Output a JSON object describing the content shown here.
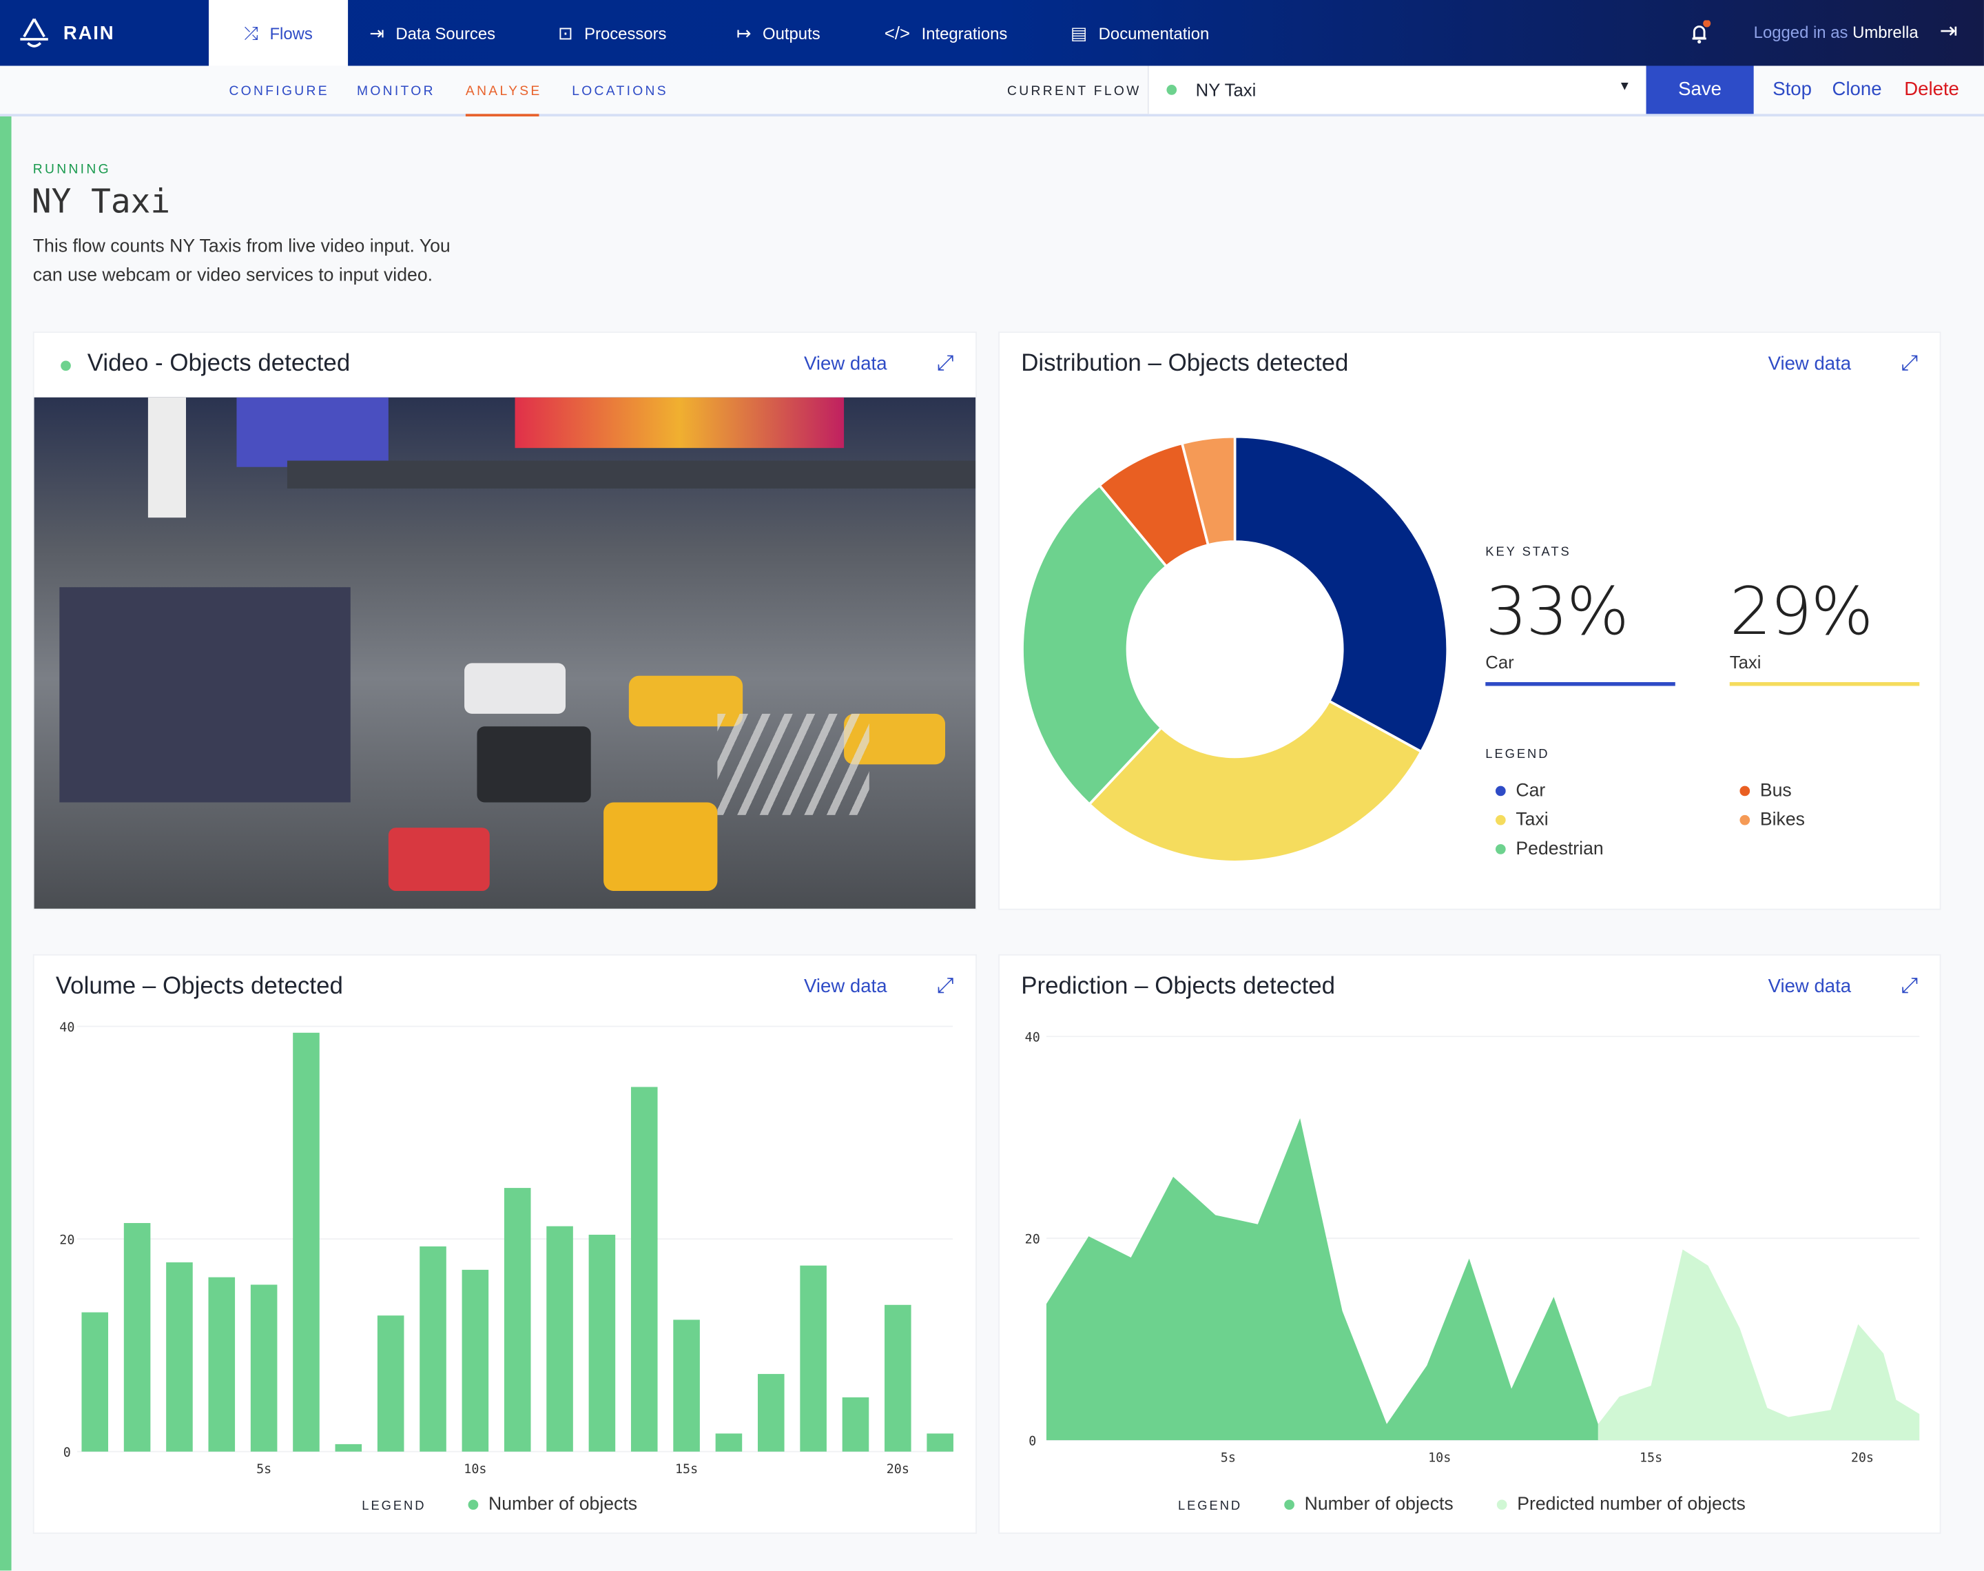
{
  "nav": {
    "brand": "RAIN",
    "items": [
      {
        "label": "Flows",
        "icon": "shuffle-icon",
        "active": true
      },
      {
        "label": "Data Sources",
        "icon": "arrow-to-right-icon"
      },
      {
        "label": "Processors",
        "icon": "robot-icon"
      },
      {
        "label": "Outputs",
        "icon": "arrow-from-bar-icon"
      },
      {
        "label": "Integrations",
        "icon": "code-icon"
      },
      {
        "label": "Documentation",
        "icon": "document-icon"
      }
    ],
    "logged_in_prefix": "Logged in as",
    "user": "Umbrella",
    "notification_color": "#e8622c"
  },
  "subnav": {
    "tabs": [
      {
        "label": "CONFIGURE"
      },
      {
        "label": "MONITOR"
      },
      {
        "label": "ANALYSE",
        "active": true
      },
      {
        "label": "LOCATIONS"
      }
    ],
    "current_flow_label": "CURRENT FLOW",
    "current_flow_value": "NY Taxi",
    "save": "Save",
    "stop": "Stop",
    "clone": "Clone",
    "delete": "Delete"
  },
  "flow": {
    "status": "RUNNING",
    "title": "NY Taxi",
    "description_line1": "This flow counts NY Taxis from live video input. You",
    "description_line2": "can use webcam or video services to input video."
  },
  "cards": {
    "video": {
      "title": "Video - Objects detected",
      "view_data": "View data"
    },
    "distribution": {
      "title": "Distribution – Objects detected",
      "view_data": "View data"
    },
    "volume": {
      "title": "Volume – Objects detected",
      "view_data": "View data"
    },
    "prediction": {
      "title": "Prediction – Objects detected",
      "view_data": "View data"
    }
  },
  "key_stats": {
    "label": "KEY STATS",
    "stats": [
      {
        "value": "33%",
        "name": "Car",
        "color": "#2e4bc6"
      },
      {
        "value": "29%",
        "name": "Taxi",
        "color": "#f5dc5d"
      }
    ],
    "legend_label": "LEGEND"
  },
  "colors": {
    "accent": "#2e4bc6",
    "running": "#6dd28e",
    "delete": "#d9161c",
    "analyse": "#e8622c"
  },
  "chart_data": [
    {
      "type": "pie",
      "donut": true,
      "categories": [
        "Car",
        "Taxi",
        "Pedestrian",
        "Bus",
        "Bikes"
      ],
      "values": [
        33,
        29,
        27,
        7,
        4
      ],
      "colors": [
        "#002685",
        "#f5dc5d",
        "#6dd28e",
        "#e95f22",
        "#f59a56"
      ],
      "legend_colors": [
        "#2e4bc6",
        "#f5dc5d",
        "#6dd28e",
        "#e95f22",
        "#f59a56"
      ]
    },
    {
      "type": "bar",
      "categories": [
        "1s",
        "2s",
        "3s",
        "4s",
        "5s",
        "6s",
        "7s",
        "8s",
        "9s",
        "10s",
        "11s",
        "12s",
        "13s",
        "14s",
        "15s",
        "16s",
        "17s",
        "18s",
        "19s",
        "20s",
        "21s"
      ],
      "values": [
        13.1,
        21.5,
        17.8,
        16.4,
        15.7,
        39.4,
        0.7,
        12.8,
        19.3,
        17.1,
        24.8,
        21.2,
        20.4,
        34.3,
        12.4,
        1.7,
        7.3,
        17.5,
        5.1,
        13.8,
        1.7
      ],
      "xticks": [
        "5s",
        "10s",
        "15s",
        "20s"
      ],
      "xtick_positions": [
        5,
        10,
        15,
        20
      ],
      "yticks": [
        "0",
        "20",
        "40"
      ],
      "ylim": [
        0,
        40
      ],
      "grid": true,
      "legend_label": "LEGEND",
      "series": [
        {
          "name": "Number of objects",
          "color": "#6dd28e"
        }
      ]
    },
    {
      "type": "area",
      "xlim": [
        0.7,
        21.35
      ],
      "ylim": [
        0,
        40
      ],
      "xticks": [
        "5s",
        "10s",
        "15s",
        "20s"
      ],
      "xtick_positions": [
        5,
        10,
        15,
        20
      ],
      "yticks": [
        "0",
        "20",
        "40"
      ],
      "grid": true,
      "legend_label": "LEGEND",
      "series": [
        {
          "name": "Number of objects",
          "color": "#6dd28e",
          "x": [
            0.7,
            1.7,
            2.7,
            3.7,
            4.7,
            5.7,
            6.7,
            7.7,
            8.75,
            9.7,
            10.7,
            11.7,
            12.7,
            13.75
          ],
          "y": [
            13.5,
            20.2,
            18.1,
            26.1,
            22.3,
            21.4,
            31.9,
            12.8,
            1.6,
            7.4,
            18.0,
            5.1,
            14.2,
            1.6
          ]
        },
        {
          "name": "Predicted number of objects",
          "color": "#d0f7d4",
          "x": [
            13.75,
            14.25,
            15.0,
            15.75,
            16.35,
            17.1,
            17.75,
            18.25,
            19.25,
            19.9,
            20.5,
            20.8,
            21.35
          ],
          "y": [
            1.6,
            4.3,
            5.4,
            18.9,
            17.3,
            11.1,
            3.2,
            2.3,
            3.0,
            11.5,
            8.6,
            4.0,
            2.6
          ]
        }
      ]
    }
  ]
}
